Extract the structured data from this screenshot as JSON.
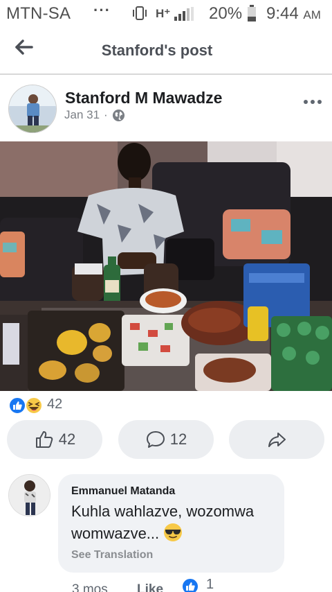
{
  "status_bar": {
    "carrier": "MTN-SA",
    "dots": "···",
    "network_type": "H⁺",
    "battery_percent": "20%",
    "time": "9:44",
    "ampm": "AM"
  },
  "header": {
    "title": "Stanford's post"
  },
  "post": {
    "author": "Stanford M Mawadze",
    "date": "Jan 31",
    "separator": "·",
    "reaction_count": "42"
  },
  "actions": {
    "like_count": "42",
    "comment_count": "12"
  },
  "comment": {
    "name": "Emmanuel Matanda",
    "text": "Kuhla wahlazve, wozomwa womwazve...",
    "see_translation": "See Translation",
    "time": "3 mos",
    "like_label": "Like",
    "like_count": "1"
  },
  "colors": {
    "facebook_blue": "#1877f2",
    "button_bg": "#eceef1",
    "bubble_bg": "#f0f2f5"
  },
  "icons": [
    "back-arrow-icon",
    "vibrate-icon",
    "signal-icon",
    "battery-icon",
    "globe-icon",
    "more-icon",
    "like-reaction-icon",
    "haha-reaction-icon",
    "thumbs-up-icon",
    "comment-icon",
    "share-icon",
    "sunglasses-emoji-icon"
  ]
}
